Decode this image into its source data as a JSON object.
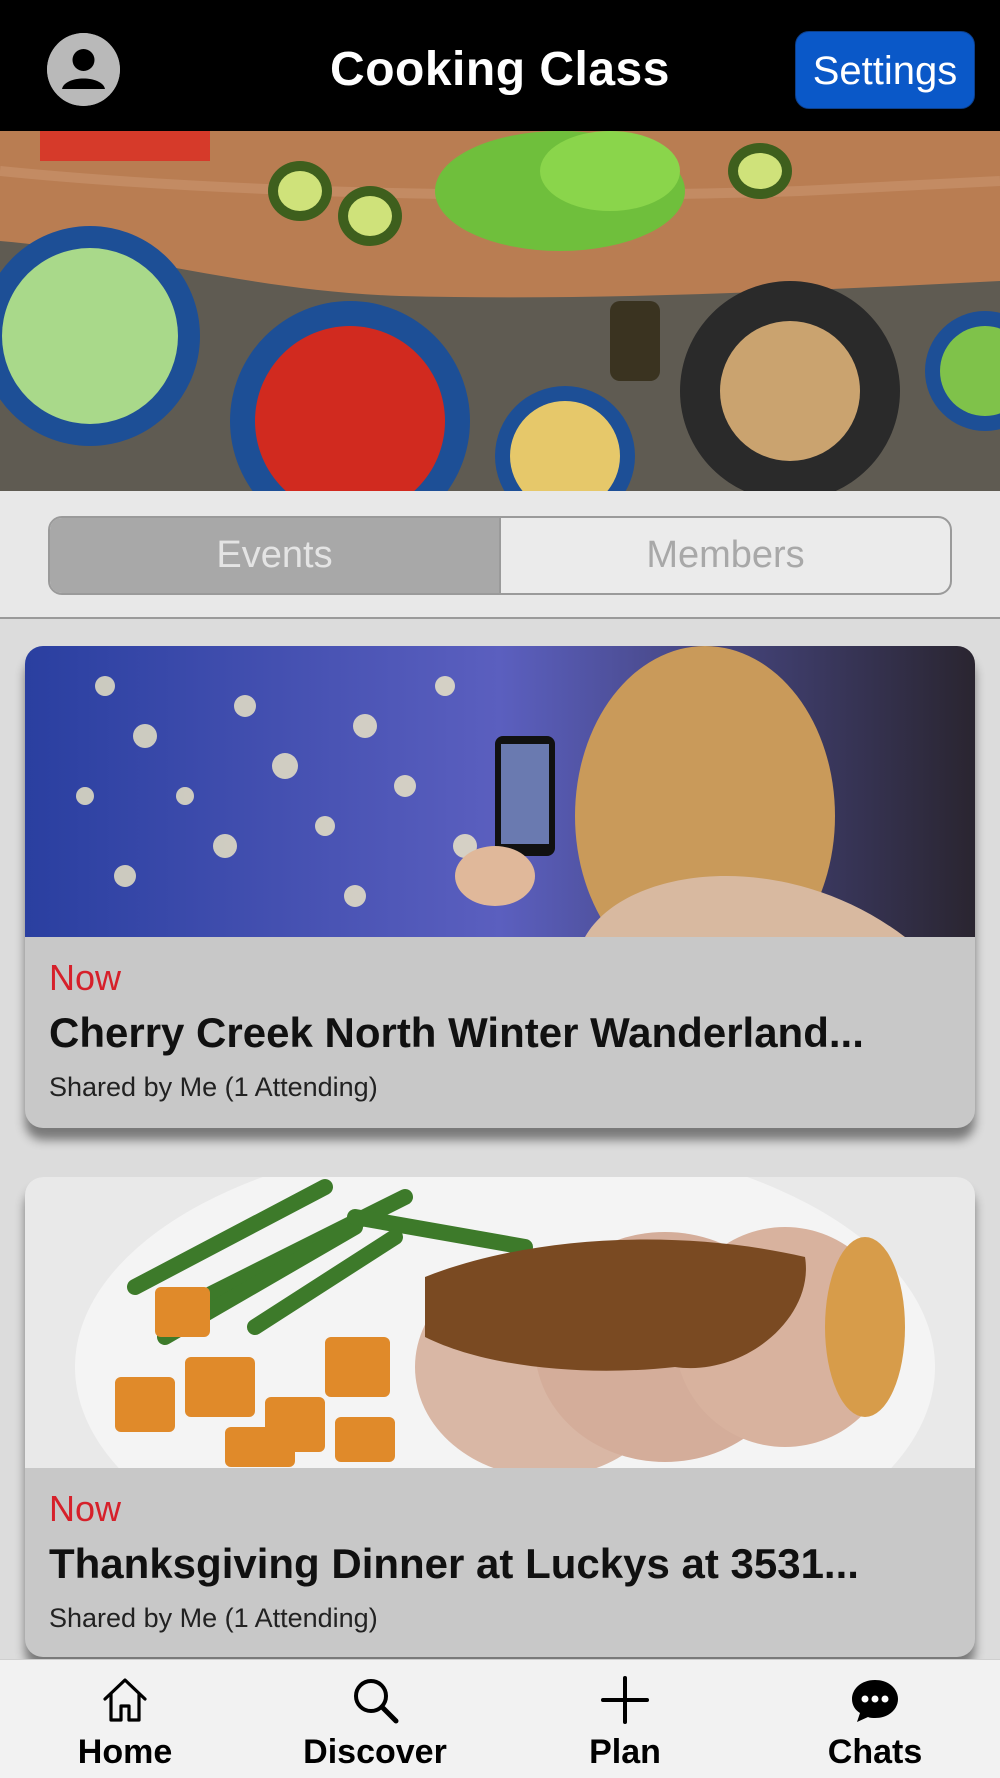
{
  "header": {
    "title": "Cooking Class",
    "settings_label": "Settings",
    "avatar_icon": "user-avatar-icon"
  },
  "hero": {
    "image": "cooking-ingredients-table-photo"
  },
  "segments": {
    "items": [
      {
        "label": "Events",
        "selected": true
      },
      {
        "label": "Members",
        "selected": false
      }
    ]
  },
  "events": [
    {
      "time": "Now",
      "title": "Cherry Creek North Winter Wanderland...",
      "subtitle": "Shared by Me (1 Attending)",
      "image": "woman-photographing-holiday-lights-photo"
    },
    {
      "time": "Now",
      "title": "Thanksgiving Dinner at Luckys at 3531...",
      "subtitle": "Shared by Me (1 Attending)",
      "image": "turkey-dinner-plate-photo"
    }
  ],
  "tabbar": {
    "items": [
      {
        "label": "Home",
        "icon": "home-icon"
      },
      {
        "label": "Discover",
        "icon": "search-icon"
      },
      {
        "label": "Plan",
        "icon": "plus-icon"
      },
      {
        "label": "Chats",
        "icon": "chat-bubble-icon"
      }
    ]
  },
  "colors": {
    "header_bg": "#000000",
    "settings_button": "#0a58c8",
    "time_label": "#d6202a",
    "tabbar_bg": "#f2f2f2"
  }
}
